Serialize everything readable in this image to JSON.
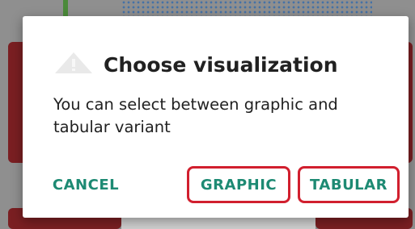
{
  "dialog": {
    "title": "Choose visualization",
    "icon": "warning-icon",
    "message": "You can select between graphic and tabular variant",
    "buttons": {
      "cancel": "CANCEL",
      "graphic": "GRAPHIC",
      "tabular": "TABULAR"
    }
  },
  "colors": {
    "button_text": "#1d8a73",
    "highlight_border": "#d11f2e",
    "scrim": "#8f8f8f"
  }
}
